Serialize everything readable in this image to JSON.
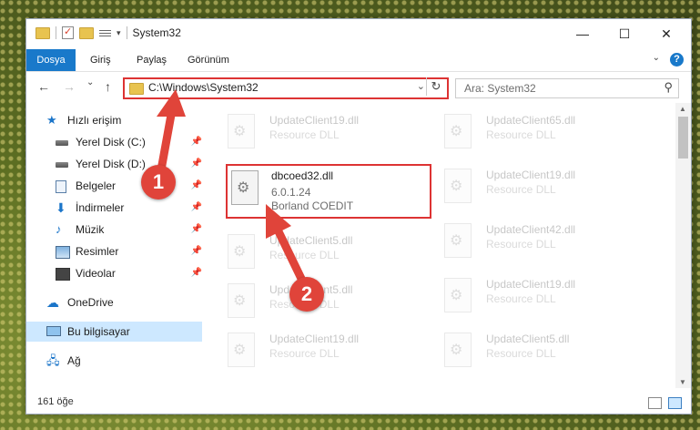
{
  "window": {
    "title": "System32",
    "minimize": "—",
    "maximize": "☐",
    "close": "✕"
  },
  "ribbon": {
    "tabs": [
      "Dosya",
      "Giriş",
      "Paylaş",
      "Görünüm"
    ],
    "help": "?"
  },
  "navigation": {
    "back": "←",
    "forward": "→",
    "recent": "⌄",
    "up": "↑",
    "address": "C:\\Windows\\System32",
    "search_placeholder": "Ara: System32"
  },
  "sidebar": {
    "items": [
      {
        "label": "Hızlı erişim",
        "icon": "star-icon"
      },
      {
        "label": "Yerel Disk (C:)",
        "icon": "disk-icon",
        "pinned": true
      },
      {
        "label": "Yerel Disk (D:)",
        "icon": "disk-icon",
        "pinned": true
      },
      {
        "label": "Belgeler",
        "icon": "document-icon",
        "pinned": true
      },
      {
        "label": "İndirmeler",
        "icon": "download-icon",
        "pinned": true
      },
      {
        "label": "Müzik",
        "icon": "music-icon",
        "pinned": true
      },
      {
        "label": "Resimler",
        "icon": "pictures-icon",
        "pinned": true
      },
      {
        "label": "Videolar",
        "icon": "video-icon",
        "pinned": true
      },
      {
        "label": "OneDrive",
        "icon": "cloud-icon"
      },
      {
        "label": "Bu bilgisayar",
        "icon": "computer-icon",
        "selected": true
      },
      {
        "label": "Ağ",
        "icon": "network-icon"
      }
    ]
  },
  "files": {
    "col1": [
      {
        "name": "UpdateClient19.dll",
        "type": "Resource DLL"
      },
      {
        "name": "dbcoed32.dll",
        "version": "6.0.1.24",
        "company": "Borland COEDIT",
        "highlighted": true
      },
      {
        "name": "UpdateClient5.dll",
        "type": "Resource DLL"
      },
      {
        "name": "UpdateClient5.dll",
        "type": "Resource DLL"
      },
      {
        "name": "UpdateClient19.dll",
        "type": "Resource DLL"
      }
    ],
    "col2": [
      {
        "name": "UpdateClient65.dll",
        "type": "Resource DLL"
      },
      {
        "name": "UpdateClient19.dll",
        "type": "Resource DLL"
      },
      {
        "name": "UpdateClient42.dll",
        "type": "Resource DLL"
      },
      {
        "name": "UpdateClient19.dll",
        "type": "Resource DLL"
      },
      {
        "name": "UpdateClient5.dll",
        "type": "Resource DLL"
      }
    ]
  },
  "status": {
    "count": "161 öğe"
  },
  "callouts": [
    "1",
    "2"
  ],
  "colors": {
    "accent": "#1979ca",
    "highlight": "#dd3333",
    "selected": "#cde8ff"
  }
}
